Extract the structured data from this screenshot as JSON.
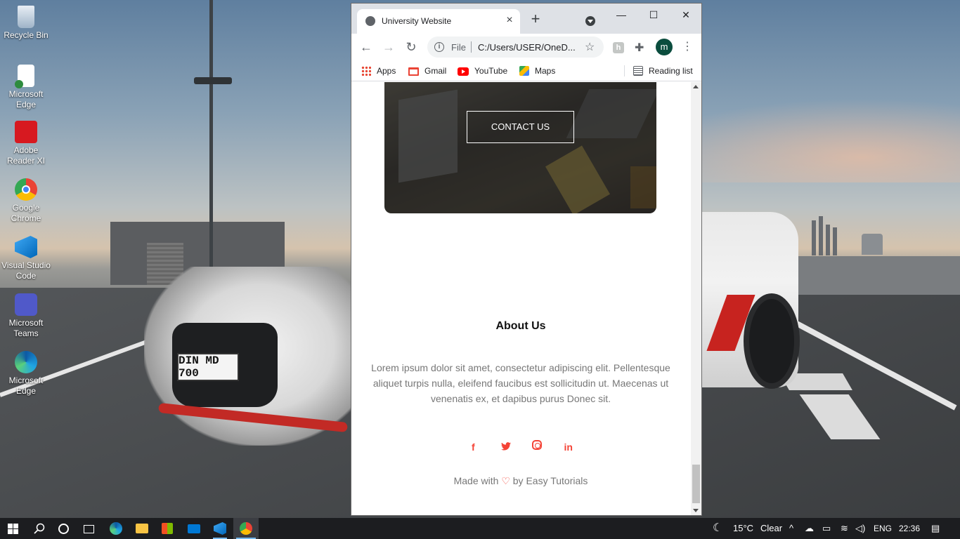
{
  "desktop": {
    "icons": [
      {
        "label": "Recycle Bin"
      },
      {
        "label": "Microsoft Edge"
      },
      {
        "label": "Adobe Reader XI"
      },
      {
        "label": "Google Chrome"
      },
      {
        "label": "Visual Studio Code"
      },
      {
        "label": "Microsoft Teams"
      },
      {
        "label": "Microsoft Edge"
      }
    ],
    "plate_text": "DIN MD 700"
  },
  "browser": {
    "tab_title": "University Website",
    "close_tab": "×",
    "new_tab": "+",
    "minimize": "—",
    "maximize": "☐",
    "close": "✕",
    "back": "←",
    "forward": "→",
    "reload": "↻",
    "omnibox": {
      "scheme_label": "File",
      "url": "C:/Users/USER/OneD...",
      "star": "☆"
    },
    "profile_initial": "m",
    "bookmarks": [
      {
        "label": "Apps",
        "icon": "apps-icon"
      },
      {
        "label": "Gmail",
        "icon": "gmail-icon"
      },
      {
        "label": "YouTube",
        "icon": "youtube-icon"
      },
      {
        "label": "Maps",
        "icon": "maps-icon"
      }
    ],
    "reading_list": "Reading list"
  },
  "page": {
    "contact_button": "CONTACT US",
    "about_title": "About Us",
    "about_text": "Lorem ipsum dolor sit amet, consectetur adipiscing elit. Pellentesque aliquet turpis nulla, eleifend faucibus est sollicitudin ut. Maecenas ut venenatis ex, et dapibus purus Donec sit.",
    "socials": [
      {
        "icon": "facebook-icon",
        "glyph": "f"
      },
      {
        "icon": "twitter-icon",
        "glyph": "t"
      },
      {
        "icon": "instagram-icon",
        "glyph": ""
      },
      {
        "icon": "linkedin-icon",
        "glyph": "in"
      }
    ],
    "footer_prefix": "Made with",
    "footer_heart": "♡",
    "footer_suffix": "by Easy Tutorials",
    "accent_color": "#f44336"
  },
  "taskbar": {
    "weather_temp": "15°C",
    "weather_desc": "Clear",
    "language": "ENG",
    "time": "22:36"
  }
}
